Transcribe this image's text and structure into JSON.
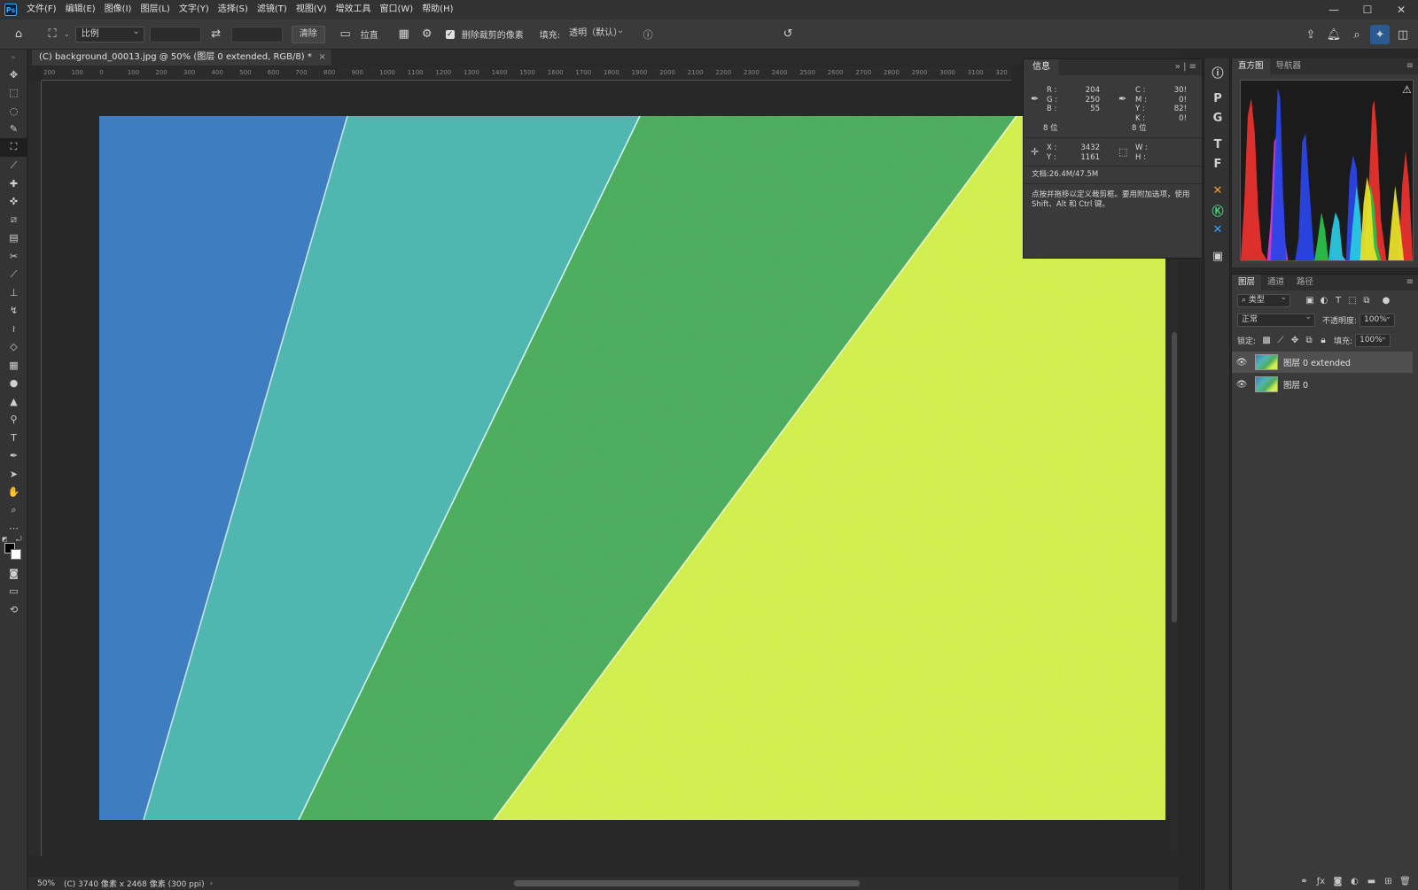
{
  "menubar": {
    "logo": "Ps",
    "items": [
      "文件(F)",
      "编辑(E)",
      "图像(I)",
      "图层(L)",
      "文字(Y)",
      "选择(S)",
      "滤镜(T)",
      "视图(V)",
      "增效工具",
      "窗口(W)",
      "帮助(H)"
    ],
    "window_controls": [
      "—",
      "☐",
      "✕"
    ]
  },
  "options": {
    "ratio_select": "比例",
    "clear_button": "清除",
    "straighten_label": "拉直",
    "delete_cropped_label": "删除裁剪的像素",
    "fill_label": "填充:",
    "fill_select": "透明（默认）"
  },
  "document": {
    "tab_title": "(C) background_00013.jpg @ 50% (图层 0 extended, RGB/8) *",
    "tab_close": "×",
    "ruler_ticks": [
      "200",
      "100",
      "0",
      "100",
      "200",
      "300",
      "400",
      "500",
      "600",
      "700",
      "800",
      "900",
      "1000",
      "1100",
      "1200",
      "1300",
      "1400",
      "1500",
      "1600",
      "1700",
      "1800",
      "1900",
      "2000",
      "2100",
      "2200",
      "2300",
      "2400",
      "2500",
      "2600",
      "2700",
      "2800",
      "2900",
      "3000",
      "3100",
      "320"
    ],
    "zoom": "50%",
    "status_info": "(C) 3740 像素 x 2468 像素 (300 ppi)",
    "status_arrow": "›",
    "canvas_colors": [
      "#3e7dc0",
      "#4fb6b0",
      "#4ead5e",
      "#d1ef4f"
    ]
  },
  "info": {
    "title": "信息",
    "r_label": "R :",
    "r_value": "204",
    "g_label": "G :",
    "g_value": "250",
    "b_label": "B :",
    "b_value": "55",
    "bit_left": "8 位",
    "c_label": "C :",
    "c_value": "30!",
    "m_label": "M :",
    "m_value": "0!",
    "y_label": "Y :",
    "y_value": "82!",
    "k_label": "K :",
    "k_value": "0!",
    "bit_right": "8 位",
    "x_label": "X :",
    "x_value": "3432",
    "yy_label": "Y :",
    "yy_value": "1161",
    "w_label": "W :",
    "h_label": "H :",
    "doc_size": "文档:26.4M/47.5M",
    "hint": "点按并拖移以定义裁剪框。要用附加选项，使用 Shift、Alt 和 Ctrl 键。"
  },
  "histogram": {
    "tabs": [
      "直方图",
      "导航器"
    ],
    "warning": "⚠"
  },
  "layers": {
    "tabs": [
      "图层",
      "通道",
      "路径"
    ],
    "filter_select": "类型",
    "blend_mode": "正常",
    "opacity_label": "不透明度:",
    "opacity_value": "100%",
    "lock_label": "锁定:",
    "fill_label": "填充:",
    "fill_value": "100%",
    "items": [
      {
        "name": "图层 0 extended",
        "visible": true,
        "selected": true
      },
      {
        "name": "图层 0",
        "visible": true,
        "selected": false
      }
    ]
  }
}
